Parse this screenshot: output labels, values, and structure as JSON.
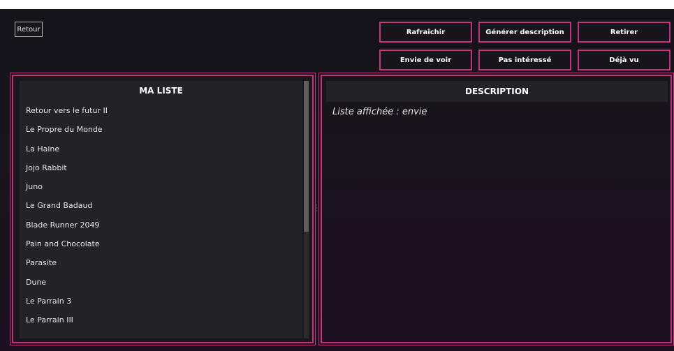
{
  "toolbar": {
    "back_label": "Retour",
    "refresh_label": "Rafraîchir",
    "generate_label": "Générer description",
    "remove_label": "Retirer",
    "want_label": "Envie de voir",
    "not_interested_label": "Pas intéressé",
    "seen_label": "Déjà vu"
  },
  "list_panel": {
    "title": "MA LISTE",
    "items": [
      "Retour vers le futur II",
      "Le Propre du Monde",
      "La Haine",
      "Jojo Rabbit",
      "Juno",
      "Le Grand Badaud",
      "Blade Runner 2049",
      "Pain and Chocolate",
      "Parasite",
      "Dune",
      "Le Parrain 3",
      "Le Parrain III"
    ]
  },
  "description_panel": {
    "title": "DESCRIPTION",
    "text": "Liste affichée : envie"
  },
  "colors": {
    "accent": "#c2317a",
    "background_top": "#14141a",
    "background_bottom": "#1d1020",
    "card": "#232327",
    "text": "#e8e8e8"
  }
}
